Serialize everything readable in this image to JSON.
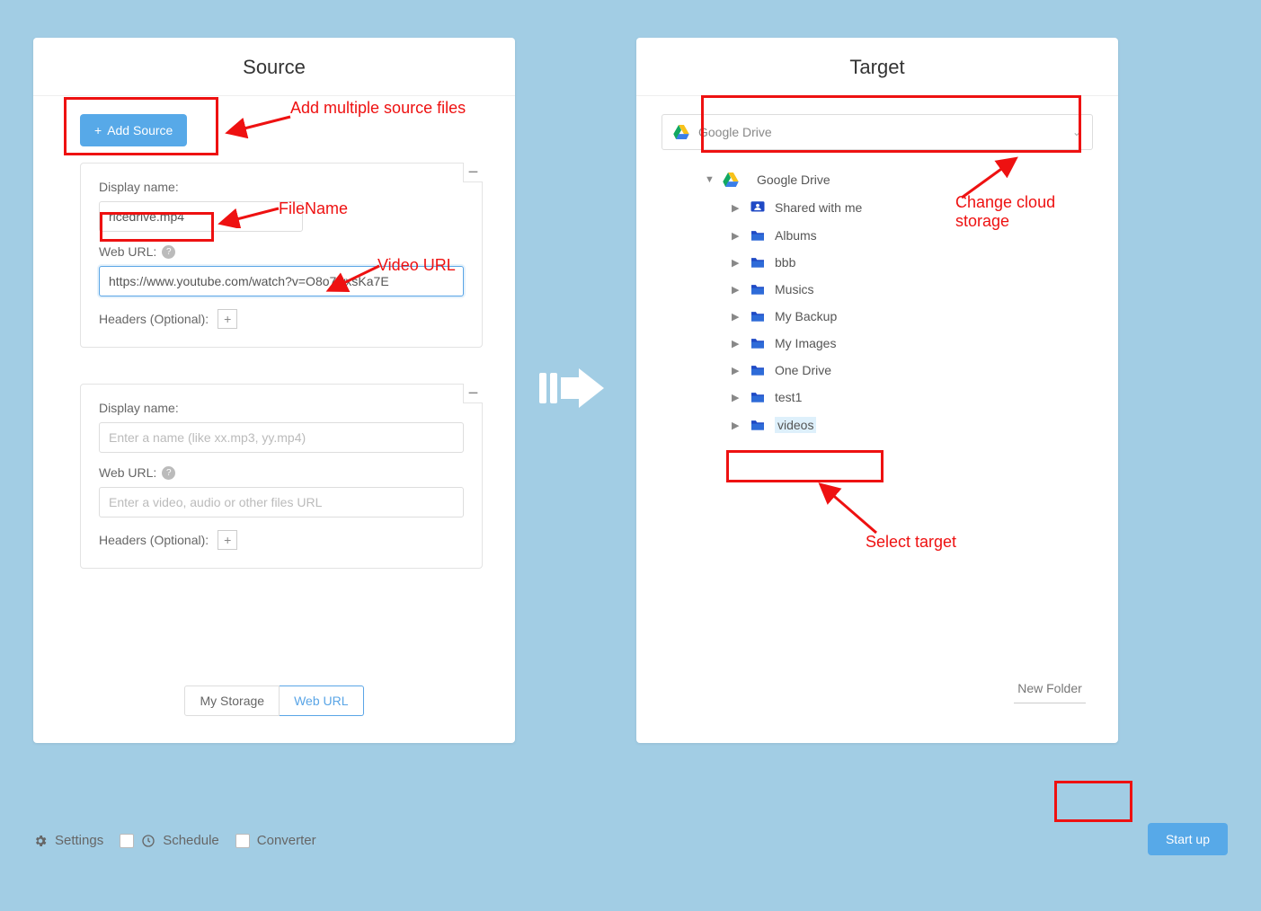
{
  "source": {
    "title": "Source",
    "add_button": "Add Source",
    "cards": [
      {
        "display_label": "Display name:",
        "display_value": "ricedrive.mp4",
        "display_placeholder": "",
        "url_label": "Web URL:",
        "url_value": "https://www.youtube.com/watch?v=O8o7wxsKa7E",
        "url_placeholder": "",
        "url_active": true,
        "headers_label": "Headers (Optional):"
      },
      {
        "display_label": "Display name:",
        "display_value": "",
        "display_placeholder": "Enter a name (like xx.mp3, yy.mp4)",
        "url_label": "Web URL:",
        "url_value": "",
        "url_placeholder": "Enter a video, audio or other files URL",
        "url_active": false,
        "headers_label": "Headers (Optional):"
      }
    ],
    "tabs": {
      "storage": "My Storage",
      "weburl": "Web URL"
    }
  },
  "target": {
    "title": "Target",
    "selected_storage": "Google Drive",
    "root": "Google Drive",
    "folders": [
      {
        "name": "Shared with me",
        "shared": true
      },
      {
        "name": "Albums",
        "shared": false
      },
      {
        "name": "bbb",
        "shared": false
      },
      {
        "name": "Musics",
        "shared": false
      },
      {
        "name": "My Backup",
        "shared": false
      },
      {
        "name": "My Images",
        "shared": false
      },
      {
        "name": "One Drive",
        "shared": false
      },
      {
        "name": "test1",
        "shared": false
      },
      {
        "name": "videos",
        "shared": false,
        "selected": true
      }
    ],
    "new_folder": "New Folder"
  },
  "bottom": {
    "settings": "Settings",
    "schedule": "Schedule",
    "converter": "Converter",
    "startup": "Start up"
  },
  "annotations": {
    "add_multiple": "Add multiple source files",
    "filename": "FileName",
    "video_url": "Video URL",
    "change_storage": "Change cloud storage",
    "select_target": "Select target"
  }
}
